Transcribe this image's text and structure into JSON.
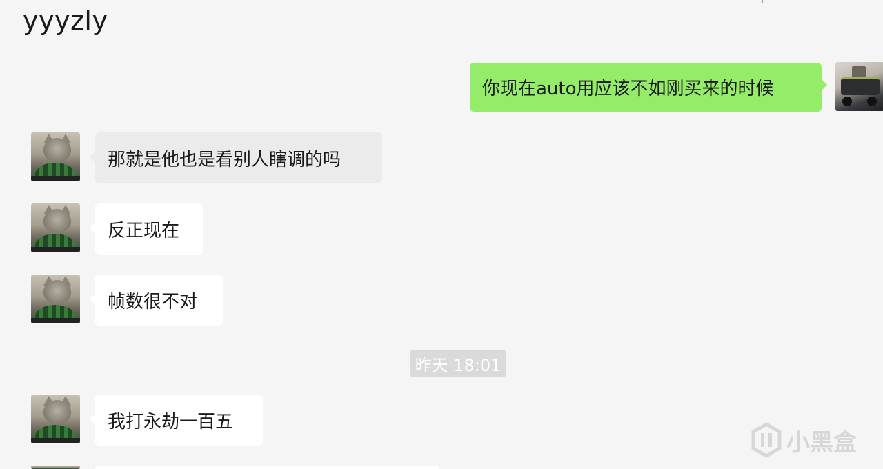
{
  "header": {
    "title": "yyyzly"
  },
  "messages": [
    {
      "side": "out",
      "text": "你现在auto用应该不如刚买来的时候"
    },
    {
      "side": "in",
      "text": "那就是他也是看别人瞎调的吗"
    },
    {
      "side": "in",
      "text": "反正现在"
    },
    {
      "side": "in",
      "text": "帧数很不对"
    },
    {
      "side": "in",
      "text": "我打永劫一百五"
    },
    {
      "side": "in",
      "text": ""
    }
  ],
  "time_divider": "昨天 18:01",
  "watermark": {
    "text": "小黑盒"
  },
  "icons": {
    "contact_avatar": "cat-avatar",
    "self_avatar": "robot-avatar",
    "watermark_logo": "heybox-logo-icon"
  },
  "colors": {
    "background": "#f5f5f5",
    "incoming_bubble": "#ffffff",
    "outgoing_bubble": "#95ec69",
    "time_divider": "#dadada"
  }
}
